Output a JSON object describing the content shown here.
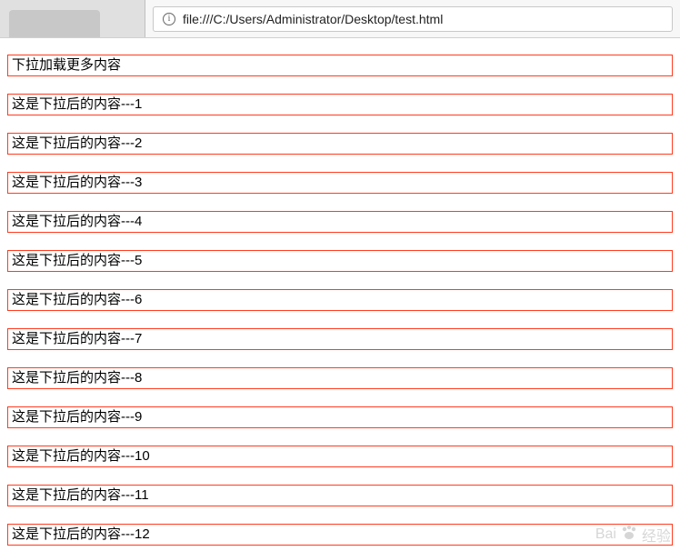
{
  "browser": {
    "url": "file:///C:/Users/Administrator/Desktop/test.html"
  },
  "content": {
    "header": "下拉加载更多内容",
    "rows": [
      "这是下拉后的内容---1",
      "这是下拉后的内容---2",
      "这是下拉后的内容---3",
      "这是下拉后的内容---4",
      "这是下拉后的内容---5",
      "这是下拉后的内容---6",
      "这是下拉后的内容---7",
      "这是下拉后的内容---8",
      "这是下拉后的内容---9",
      "这是下拉后的内容---10",
      "这是下拉后的内容---11",
      "这是下拉后的内容---12"
    ]
  },
  "watermark": {
    "brand": "Bai",
    "sub": "经验"
  }
}
